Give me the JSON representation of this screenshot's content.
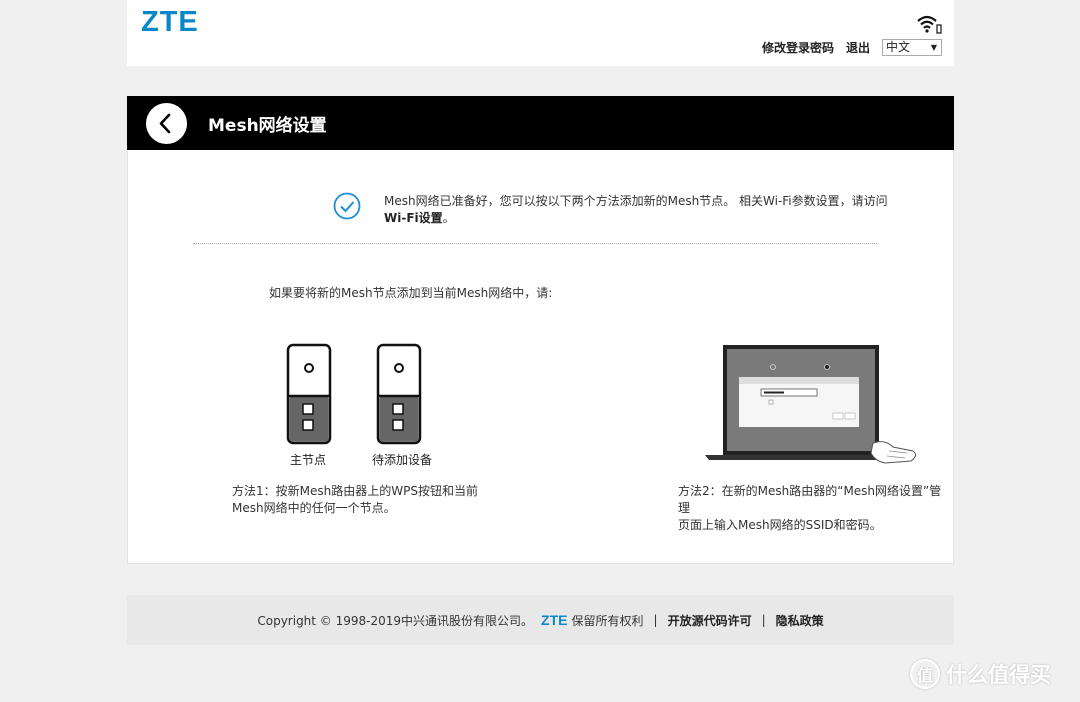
{
  "header": {
    "logo": "ZTE",
    "change_password": "修改登录密码",
    "logout": "退出",
    "language": "中文"
  },
  "titlebar": {
    "title": "Mesh网络设置"
  },
  "content": {
    "notice_text": "Mesh网络已准备好，您可以按以下两个方法添加新的Mesh节点。 相关Wi-Fi参数设置，请访问",
    "notice_link": "Wi-Fi设置",
    "notice_end": "。",
    "intro": "如果要将新的Mesh节点添加到当前Mesh网络中，请:",
    "node_main_label": "主节点",
    "node_new_label": "待添加设备",
    "method1_line1": "方法1：按新Mesh路由器上的WPS按钮和当前",
    "method1_line2": "Mesh网络中的任何一个节点。",
    "method2_line1": "方法2：在新的Mesh路由器的“Mesh网络设置”管理",
    "method2_line2": "页面上输入Mesh网络的SSID和密码。"
  },
  "footer": {
    "copyright": "Copyright © 1998-2019中兴通讯股份有限公司。",
    "logo": "ZTE",
    "rights": "保留所有权利",
    "sep": "|",
    "open_source": "开放源代码许可",
    "privacy": "隐私政策"
  },
  "watermark": {
    "icon_text": "值",
    "text": "什么值得买"
  },
  "colors": {
    "brand": "#0a87c9",
    "titlebar": "#000000",
    "background": "#f0f0f0"
  }
}
